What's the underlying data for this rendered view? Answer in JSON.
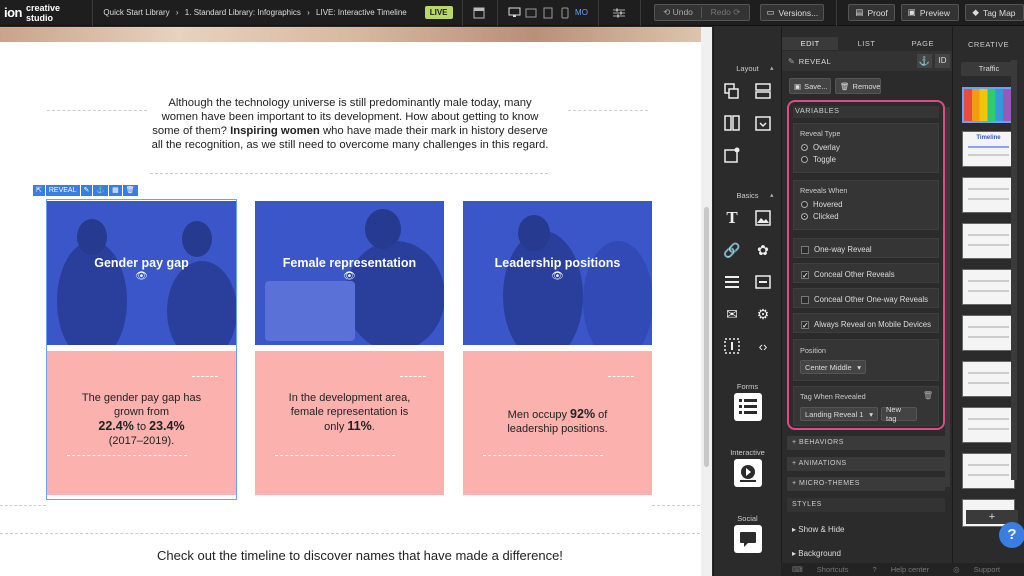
{
  "app": {
    "logo": "ion",
    "product": "creative studio",
    "live_badge": "LIVE"
  },
  "breadcrumb": [
    "Quick Start Library",
    "›",
    "1. Standard Library: Infographics",
    "›",
    "LIVE: Interactive Timeline"
  ],
  "toolbar": {
    "device_mo": "MO",
    "undo": "Undo",
    "redo": "Redo",
    "versions": "Versions...",
    "proof": "Proof",
    "preview": "Preview",
    "tag_map": "Tag Map"
  },
  "canvas": {
    "intro_pre": "Although the technology universe is still predominantly male today, many women have been important to its development. How about getting to know some of them? ",
    "intro_bold": "Inspiring women",
    "intro_post": " who have made their mark in history deserve all the recognition, as we still need to overcome many challenges in this regard.",
    "reveal_tag": "REVEAL",
    "cards": [
      {
        "title": "Gender pay gap",
        "t1": "The gender pay gap has grown from",
        "b1": "22.4%",
        "mid": " to ",
        "b2": "23.4%",
        "t2": "(2017–2019)."
      },
      {
        "title": "Female representation",
        "t1": "In the development area, female representation is only",
        "b1": "11%",
        "t2": "."
      },
      {
        "title": "Leadership positions",
        "t1": "Men occupy ",
        "b1": "92%",
        "t2": " of leadership positions."
      }
    ],
    "outro": "Check out the timeline to discover names that have made a difference!"
  },
  "tools": {
    "layout": "Layout",
    "basics": "Basics",
    "forms": "Forms",
    "interactive": "Interactive",
    "social": "Social"
  },
  "props": {
    "tabs": [
      "EDIT",
      "LIST",
      "PAGE"
    ],
    "element": "REVEAL",
    "id_label": "ID",
    "save": "Save...",
    "remove": "Remove",
    "variables_title": "VARIABLES",
    "reveal_type_label": "Reveal Type",
    "reveal_type_options": [
      "Overlay",
      "Toggle"
    ],
    "reveals_when_label": "Reveals When",
    "reveals_when_options": [
      "Hovered",
      "Clicked"
    ],
    "checkboxes": [
      "One-way Reveal",
      "Conceal Other Reveals",
      "Conceal Other One-way Reveals",
      "Always Reveal on Mobile Devices"
    ],
    "position_label": "Position",
    "position_value": "Center Middle",
    "tag_label": "Tag When Revealed",
    "tag_value": "Landing Reveal 1",
    "new_tag": "New tag",
    "sections": [
      "+ BEHAVIORS",
      "+ ANIMATIONS",
      "+ MICRO-THEMES"
    ],
    "styles": "STYLES",
    "show_hide": "Show & Hide",
    "background": "Background"
  },
  "creative": {
    "tab": "CREATIVE",
    "traffic": "Traffic",
    "thumb_title": "Timeline",
    "add": "+"
  },
  "footer": {
    "shortcuts": "Shortcuts",
    "help": "Help center",
    "support": "Support"
  },
  "colors": {
    "accent_pink": "#e0488a",
    "card_blue": "#3a56c9",
    "card_pink": "#fbb2ae",
    "live": "#b8d86b",
    "selection": "#3b7de0"
  }
}
